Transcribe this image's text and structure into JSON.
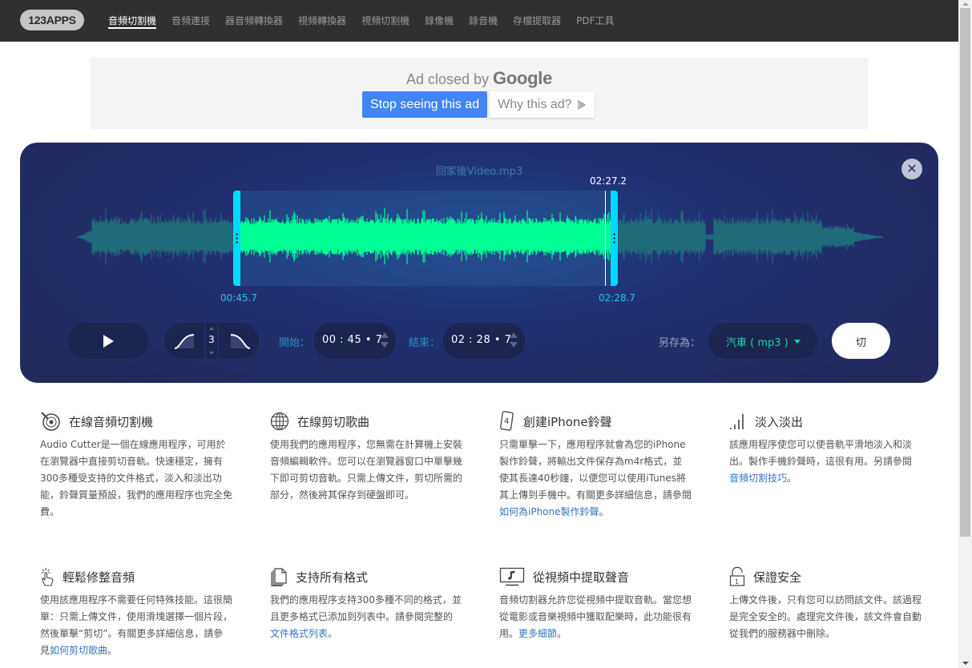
{
  "header": {
    "logo": "123APPS",
    "nav": [
      {
        "label": "音頻切割機",
        "active": true
      },
      {
        "label": "音頻連接",
        "active": false
      },
      {
        "label": "器音頻轉換器",
        "active": false
      },
      {
        "label": "視頻轉換器",
        "active": false
      },
      {
        "label": "視頻切割機",
        "active": false
      },
      {
        "label": "錄像機",
        "active": false
      },
      {
        "label": "錄音機",
        "active": false
      },
      {
        "label": "存檔提取器",
        "active": false
      },
      {
        "label": "PDF工具",
        "active": false
      }
    ]
  },
  "ad": {
    "closed_text": "Ad closed by",
    "brand": "Google",
    "stop_label": "Stop seeing this ad",
    "why_label": "Why this ad?"
  },
  "editor": {
    "filename": "回家後Video.mp3",
    "playhead_time": "02:27.2",
    "selection_start_label": "00:45.7",
    "selection_end_label": "02:28.7",
    "fade_value": "3",
    "start_label": "開始：",
    "start_value": "00 : 45 • 7",
    "end_label": "結束：",
    "end_value": "02 : 28 • 7",
    "save_as_label": "另存為：",
    "format_value": "汽車 ( mp3 )",
    "cut_label": "切",
    "close_symbol": "✕",
    "colors": {
      "selected_wave": "#00ff95",
      "unselected_wave": "#1f6b7a",
      "handle": "#00d9ff",
      "accent_text": "#2bc0f0"
    }
  },
  "features": [
    {
      "icon": "vinyl-record-icon",
      "title": "在線音頻切割機",
      "text_before": "Audio Cutter是一個在線應用程序，可用於在瀏覽器中直接剪切音軌。快速穩定，擁有300多種受支持的文件格式，淡入和淡出功能，鈴聲質量預設，我們的應用程序也完全免費。",
      "link": "",
      "text_after": ""
    },
    {
      "icon": "globe-icon",
      "title": "在線剪切歌曲",
      "text_before": "使用我們的應用程序，您無需在計算機上安裝音頻編輯軟件。您可以在瀏覽器窗口中單擊幾下即可剪切音軌。只需上傳文件，剪切所需的部分，然後將其保存到硬盤即可。",
      "link": "",
      "text_after": ""
    },
    {
      "icon": "iphone-icon",
      "title": "創建iPhone鈴聲",
      "text_before": "只需單擊一下，應用程序就會為您的iPhone製作鈴聲，將輸出文件保存為m4r格式，並使其長達40秒鐘，以便您可以使用iTunes將其上傳到手機中。有關更多詳細信息，請參閱",
      "link": "如何為iPhone製作鈴聲",
      "text_after": "。"
    },
    {
      "icon": "volume-bars-icon",
      "title": "淡入淡出",
      "text_before": "該應用程序使您可以使音軌平滑地淡入和淡出。製作手機鈴聲時，這很有用。另請參閱",
      "link": "音頻切割技巧",
      "text_after": "。"
    },
    {
      "icon": "pointer-hand-icon",
      "title": "輕鬆修整音頻",
      "text_before": "使用該應用程序不需要任何特殊技能。這很簡單：只需上傳文件，使用滑塊選擇一個片段，然後單擊“剪切”。有關更多詳細信息，請參見",
      "link": "如何剪切歌曲",
      "text_after": "。"
    },
    {
      "icon": "documents-icon",
      "title": "支持所有格式",
      "text_before": "我們的應用程序支持300多種不同的格式，並且更多格式已添加到列表中。請參閱完整的",
      "link": "文件格式列表",
      "text_after": "。"
    },
    {
      "icon": "video-music-icon",
      "title": "從視頻中提取聲音",
      "text_before": "音頻切割器允許您從視頻中提取音軌。當您想從電影或音樂視頻中獲取配樂時，此功能很有用。",
      "link": "更多細節",
      "text_after": "。"
    },
    {
      "icon": "lock-icon",
      "title": "保證安全",
      "text_before": "上傳文件後，只有您可以訪問該文件。該過程是完全安全的。處理完文件後，該文件會自動從我們的服務器中刪除。",
      "link": "",
      "text_after": ""
    }
  ]
}
